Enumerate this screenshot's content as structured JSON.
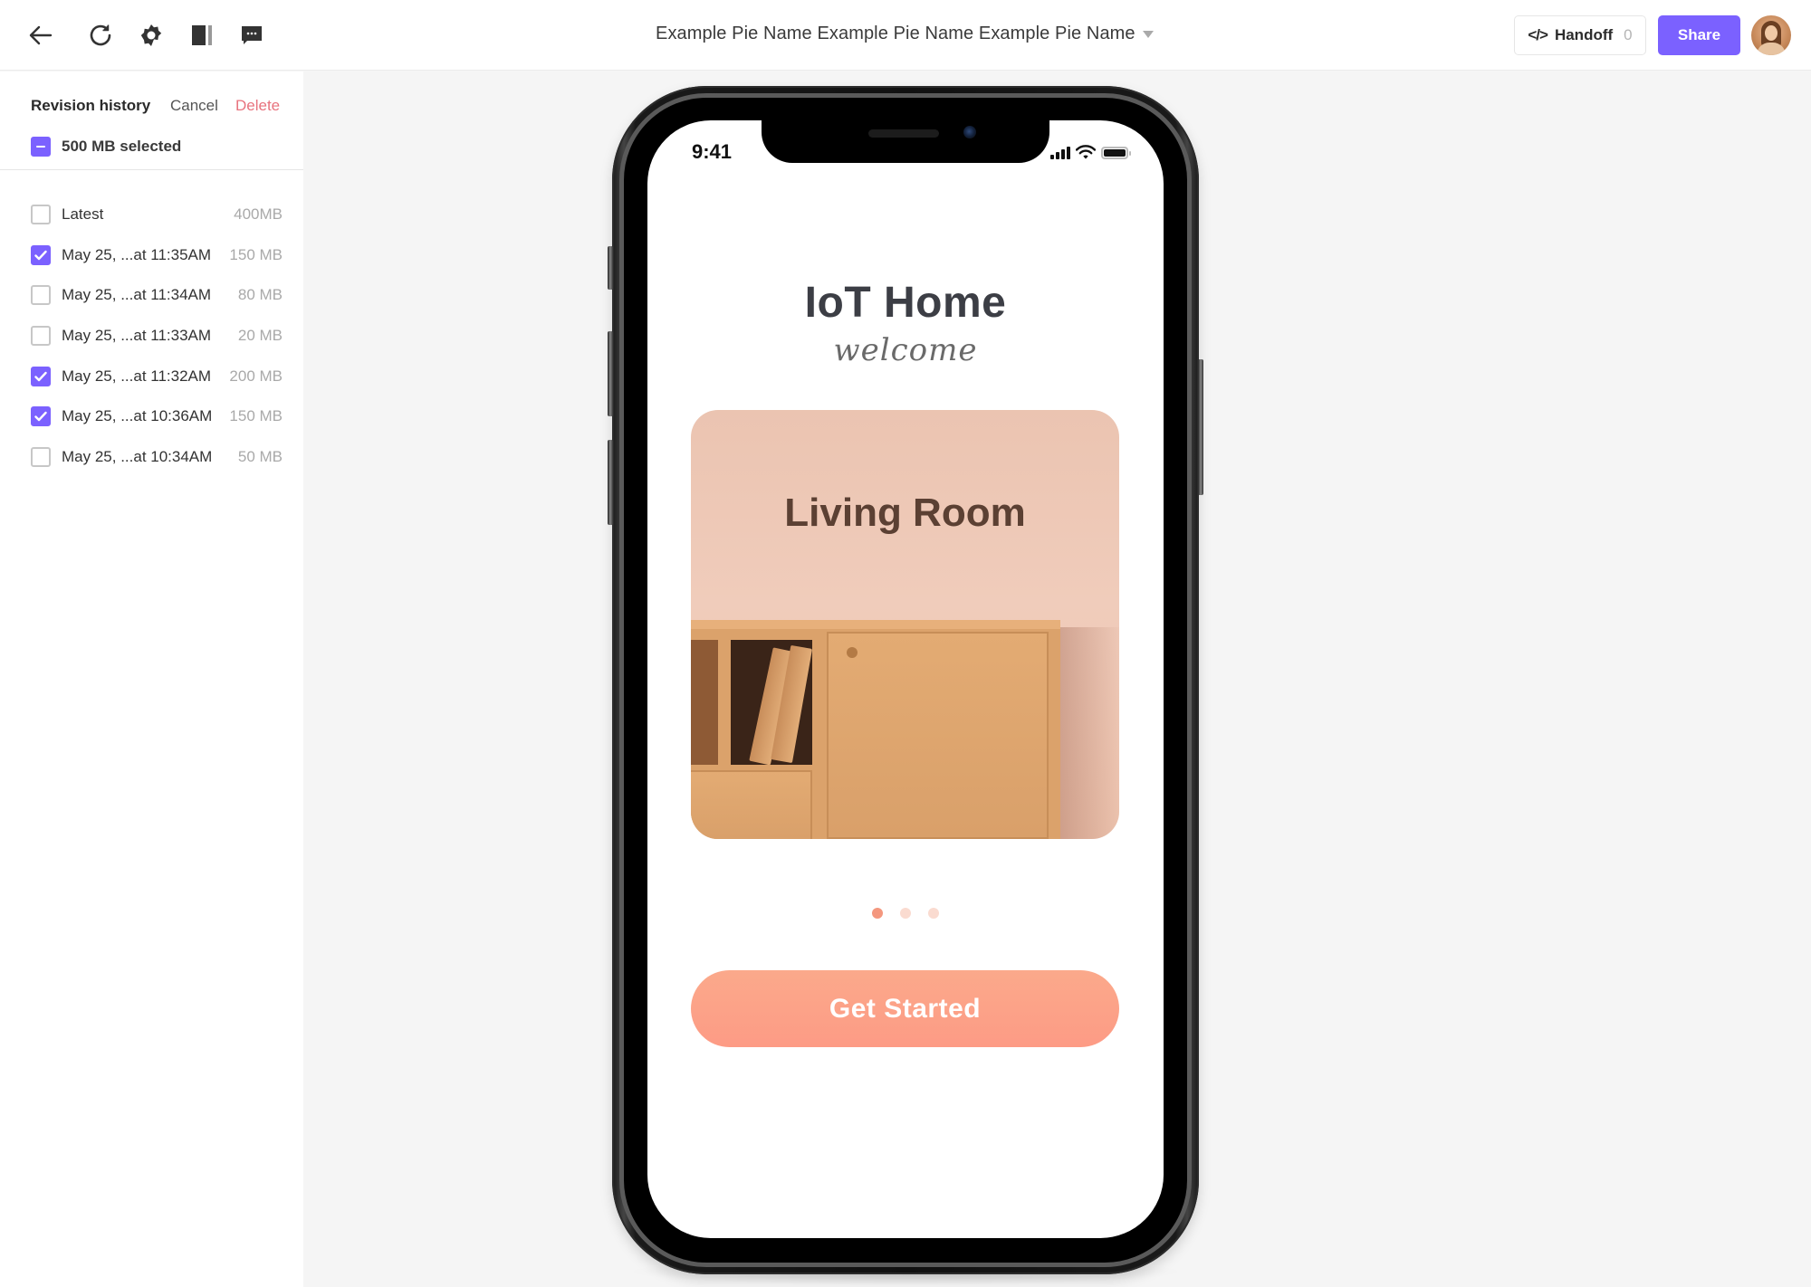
{
  "header": {
    "icons": [
      "back-arrow-icon",
      "refresh-icon",
      "settings-gear-icon",
      "panel-toggle-icon",
      "comments-icon"
    ],
    "document_title": "Example Pie Name Example Pie Name Example Pie Name",
    "handoff": {
      "icon": "code-icon",
      "label": "Handoff",
      "count": "0"
    },
    "share_label": "Share",
    "avatar": "user-avatar"
  },
  "sidebar": {
    "title": "Revision history",
    "cancel_label": "Cancel",
    "delete_label": "Delete",
    "selected_summary": "500 MB selected",
    "revisions": [
      {
        "name": "Latest",
        "size": "400MB",
        "checked": false
      },
      {
        "name": "May 25, ...at 11:35AM",
        "size": "150 MB",
        "checked": true
      },
      {
        "name": "May 25, ...at 11:34AM",
        "size": "80 MB",
        "checked": false
      },
      {
        "name": "May 25, ...at 11:33AM",
        "size": "20 MB",
        "checked": false
      },
      {
        "name": "May 25, ...at 11:32AM",
        "size": "200 MB",
        "checked": true
      },
      {
        "name": "May 25, ...at 10:36AM",
        "size": "150 MB",
        "checked": true
      },
      {
        "name": "May 25, ...at 10:34AM",
        "size": "50 MB",
        "checked": false
      }
    ]
  },
  "phone": {
    "status_time": "9:41",
    "app_title": "IoT Home",
    "app_subtitle": "welcome",
    "card_title": "Living Room",
    "pager": {
      "total": 3,
      "active": 0
    },
    "cta_label": "Get Started"
  },
  "colors": {
    "accent": "#7b61ff",
    "delete": "#e8737e",
    "cta": "#fd9f87",
    "pager_active": "#f4977e",
    "pager_inactive": "#fadbd0"
  }
}
